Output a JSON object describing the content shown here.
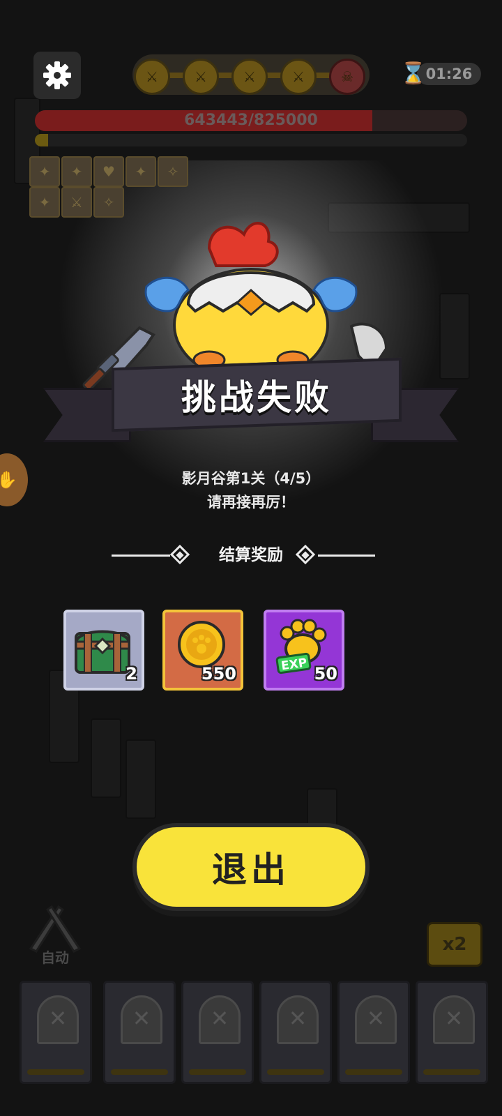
{
  "hud": {
    "timer": "01:26",
    "boss_hp_text": "643443/825000",
    "boss_hp_fraction": 0.78,
    "exp_fraction": 0.03,
    "stage_nodes": [
      "sword-icon",
      "sword-icon",
      "sword-icon",
      "sword-icon",
      "boss-icon"
    ]
  },
  "result": {
    "title": "挑战失败",
    "stage_line": "影月谷第1关（4/5）",
    "encourage_line": "请再接再厉！",
    "rewards_heading": "结算奖励",
    "rewards": [
      {
        "icon": "treasure-chest-icon",
        "count": "2"
      },
      {
        "icon": "gold-coin-icon",
        "count": "550"
      },
      {
        "icon": "exp-paw-icon",
        "count": "50",
        "tag": "EXP"
      }
    ],
    "exit_label": "退出"
  },
  "bottom": {
    "auto_label": "自动",
    "speed_label": "x2"
  },
  "colors": {
    "exit_button": "#f9e33a",
    "coin_tile": "#d36b45",
    "exp_tile": "#9436d6",
    "chest_tile": "#a5a9c6"
  }
}
